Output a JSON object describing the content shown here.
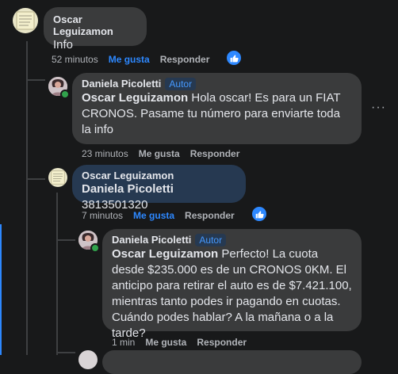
{
  "comments": [
    {
      "author": "Oscar Leguizamon",
      "text": "Info",
      "time": "52 minutos",
      "like": "Me gusta",
      "reply": "Responder"
    },
    {
      "author": "Daniela Picoletti",
      "badge": "Autor",
      "mention": "Oscar Leguizamon",
      "text": " Hola oscar! Es para un FIAT CRONOS. Pasame tu número para enviarte toda la info",
      "time": "23 minutos",
      "like": "Me gusta",
      "reply": "Responder"
    },
    {
      "author": "Oscar Leguizamon",
      "mention": "Daniela Picoletti",
      "text": " 3813501320",
      "time": "7 minutos",
      "like": "Me gusta",
      "reply": "Responder"
    },
    {
      "author": "Daniela Picoletti",
      "badge": "Autor",
      "mention": "Oscar Leguizamon",
      "text": " Perfecto! La cuota desde $235.000 es de un CRONOS 0KM. El anticipo para retirar el auto es de $7.421.100, mientras tanto podes ir pagando en cuotas. Cuándo podes hablar? A la mañana o a la tarde?",
      "time": "1 min",
      "like": "Me gusta",
      "reply": "Responder"
    }
  ],
  "more_label": "···"
}
